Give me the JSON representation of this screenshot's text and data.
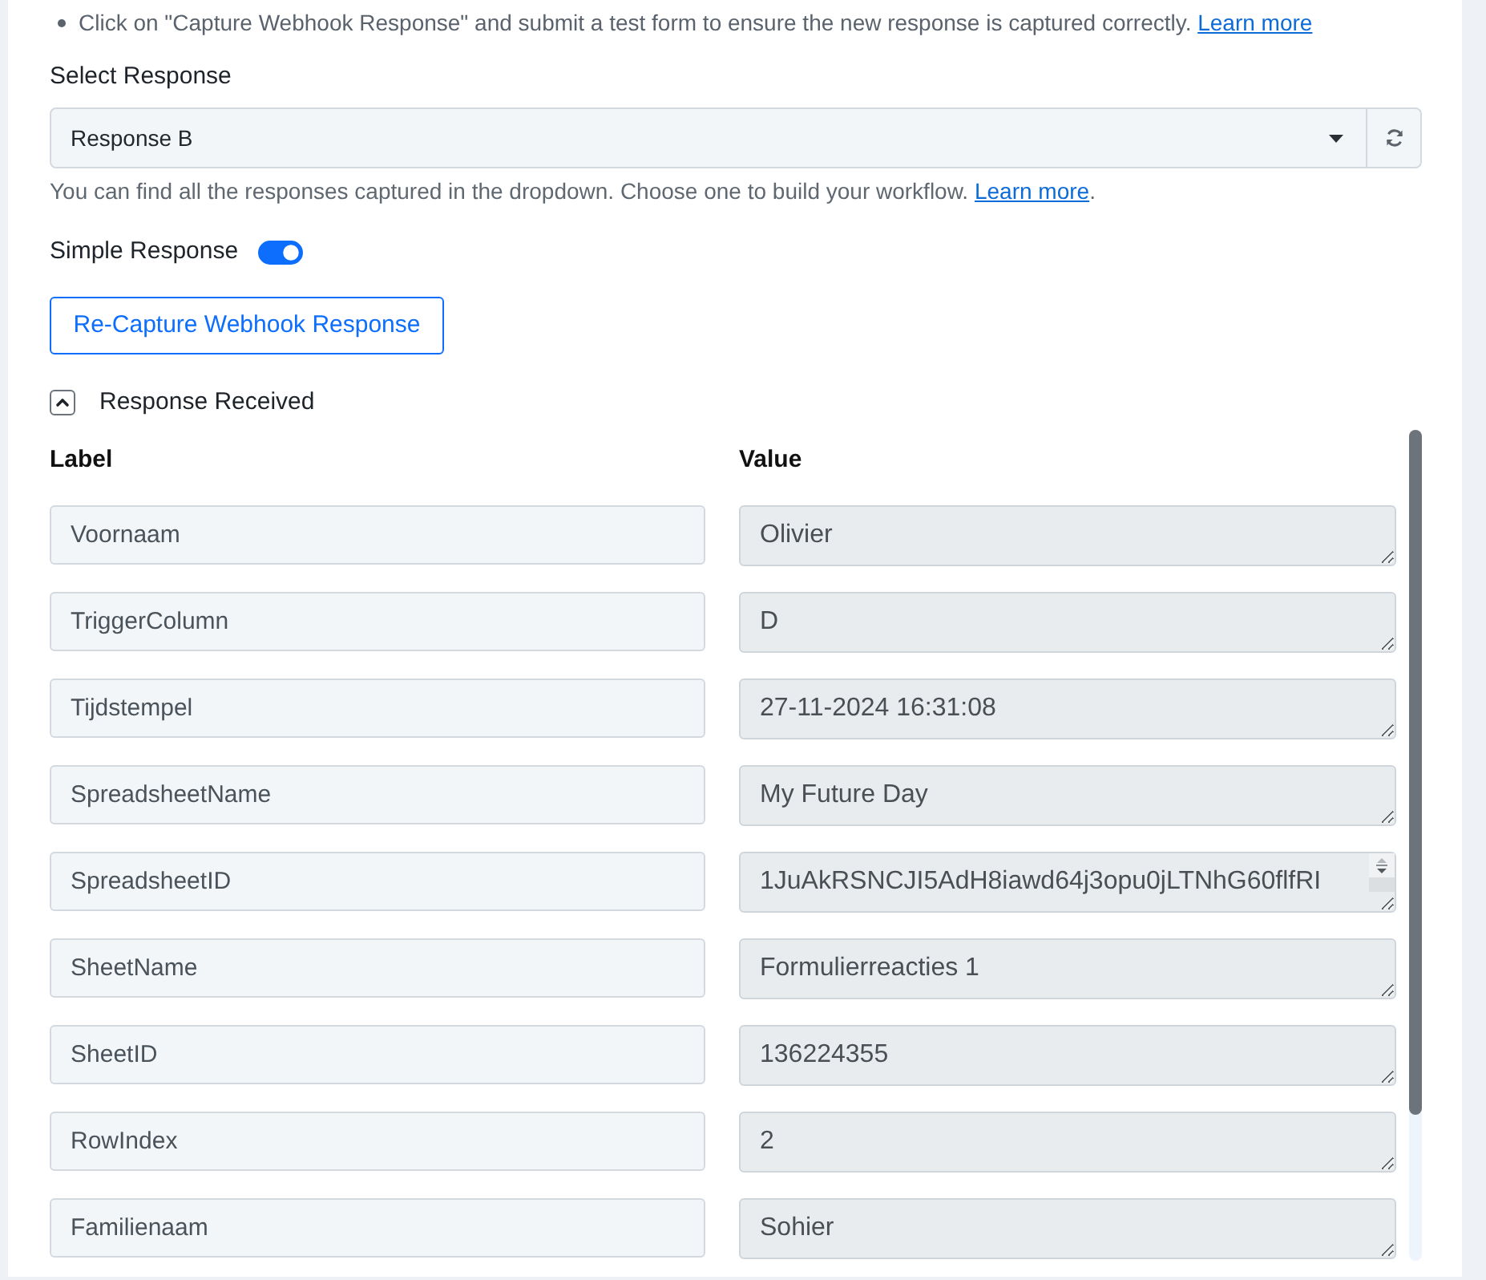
{
  "notes": [
    {
      "text": "Click on \"Capture Webhook Response\" and submit a test form to ensure the new response is captured correctly.",
      "link": "Learn more"
    }
  ],
  "select_response": {
    "label": "Select Response",
    "value": "Response B",
    "help": "You can find all the responses captured in the dropdown. Choose one to build your workflow.",
    "help_link": "Learn more",
    "help_end": "."
  },
  "simple_response": {
    "label": "Simple Response",
    "on": true
  },
  "recapture_button": "Re-Capture Webhook Response",
  "response_section": {
    "title": "Response Received",
    "expanded": true,
    "columns": [
      "Label",
      "Value"
    ],
    "rows": [
      {
        "label": "Voornaam",
        "value": "Olivier",
        "scrollable": false
      },
      {
        "label": "TriggerColumn",
        "value": "D",
        "scrollable": false
      },
      {
        "label": "Tijdstempel",
        "value": "27-11-2024 16:31:08",
        "scrollable": false
      },
      {
        "label": "SpreadsheetName",
        "value": "My Future Day",
        "scrollable": false
      },
      {
        "label": "SpreadsheetID",
        "value": "1JuAkRSNCJI5AdH8iawd64j3opu0jLTNhG60flfRI",
        "scrollable": true
      },
      {
        "label": "SheetName",
        "value": "Formulierreacties 1",
        "scrollable": false
      },
      {
        "label": "SheetID",
        "value": "136224355",
        "scrollable": false
      },
      {
        "label": "RowIndex",
        "value": "2",
        "scrollable": false
      },
      {
        "label": "Familienaam",
        "value": "Sohier",
        "scrollable": false
      }
    ]
  }
}
